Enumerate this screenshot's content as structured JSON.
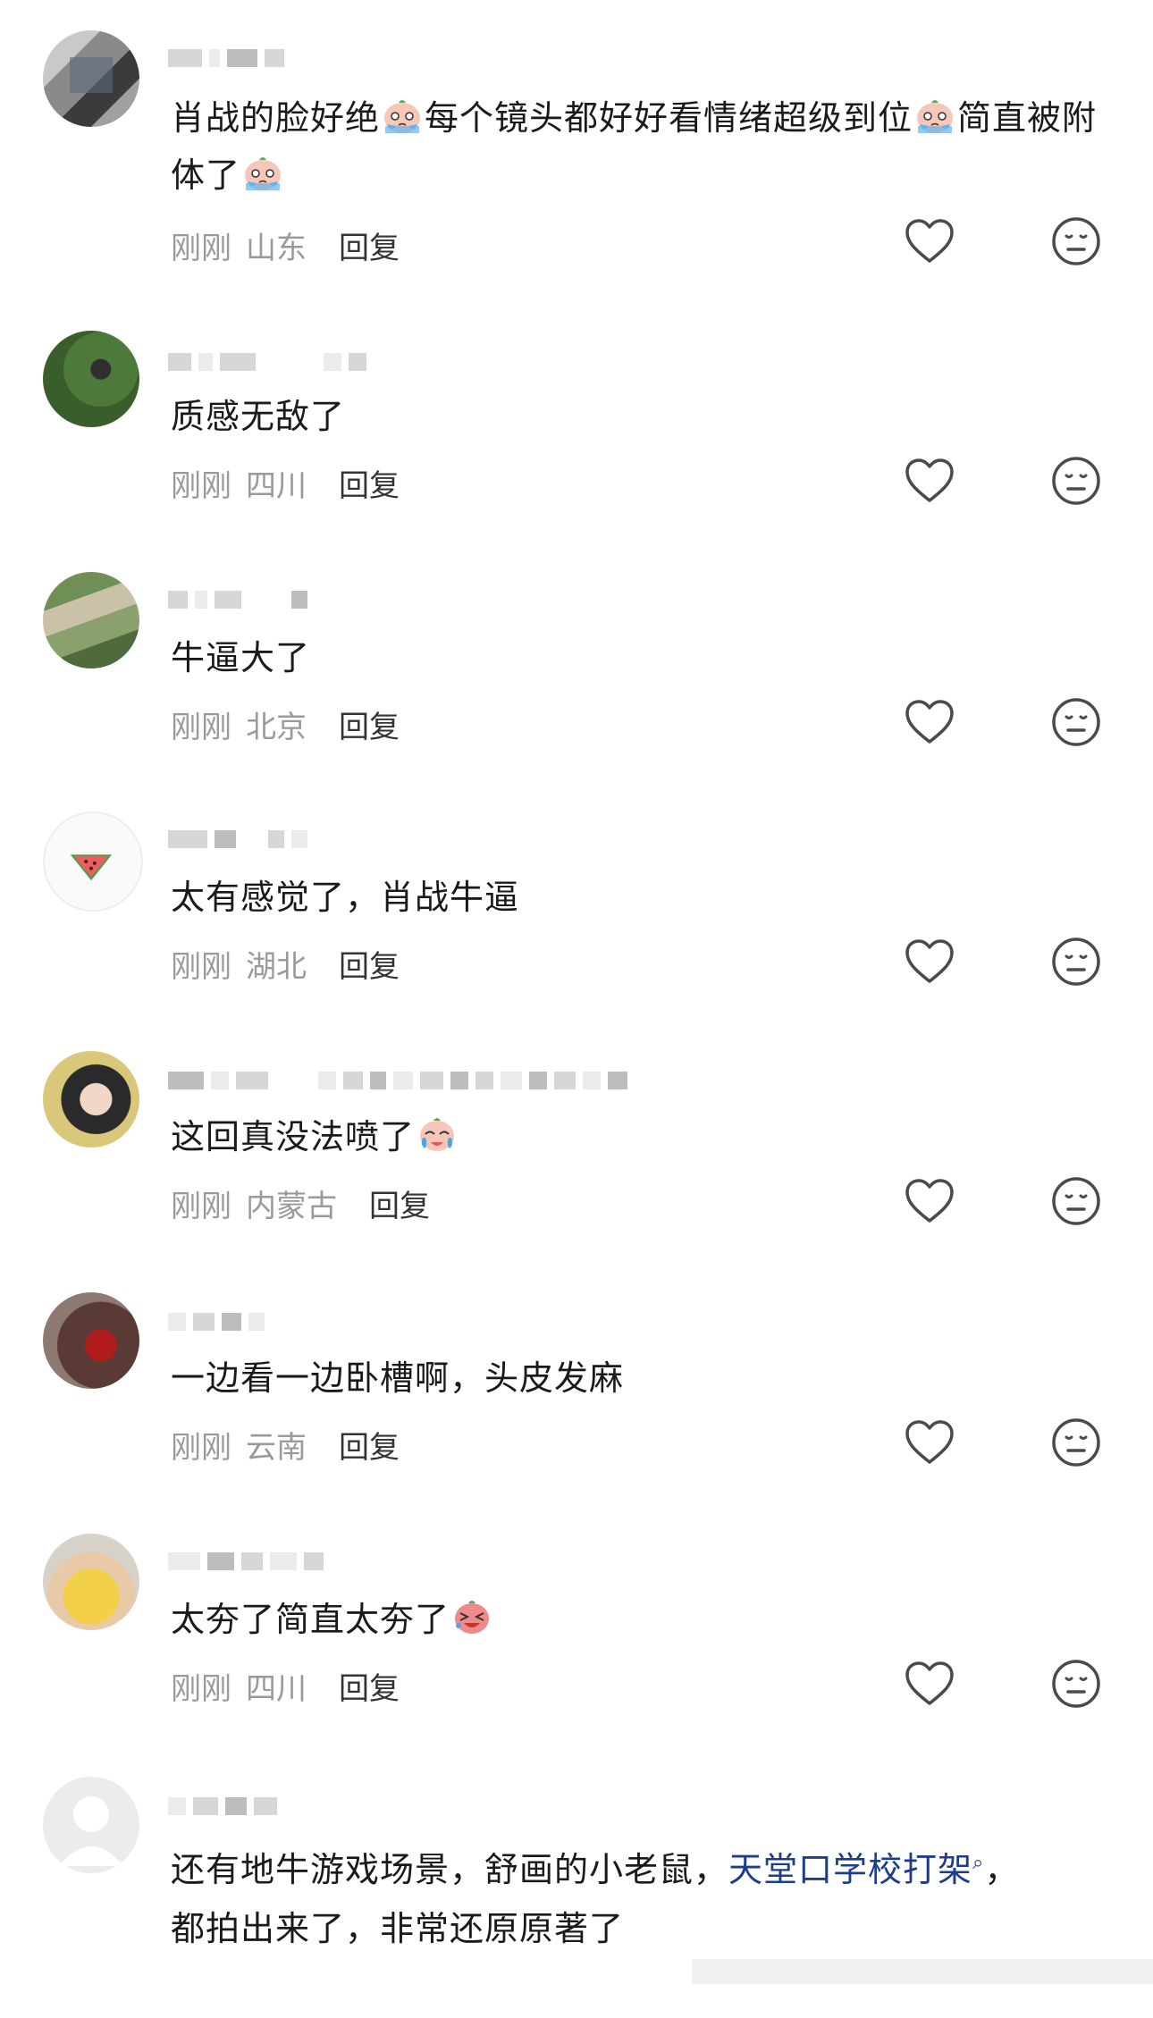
{
  "comments": [
    {
      "text_parts": [
        "肖战的脸好绝",
        "每个镜头都好好看情绪超级到位",
        "简直被附体了"
      ],
      "time": "刚刚",
      "location": "山东",
      "reply": "回复"
    },
    {
      "text": "质感无敌了",
      "time": "刚刚",
      "location": "四川",
      "reply": "回复"
    },
    {
      "text": "牛逼大了",
      "time": "刚刚",
      "location": "北京",
      "reply": "回复"
    },
    {
      "text": "太有感觉了，肖战牛逼",
      "time": "刚刚",
      "location": "湖北",
      "reply": "回复"
    },
    {
      "text": "这回真没法喷了",
      "time": "刚刚",
      "location": "内蒙古",
      "reply": "回复"
    },
    {
      "text": "一边看一边卧槽啊，头皮发麻",
      "time": "刚刚",
      "location": "云南",
      "reply": "回复"
    },
    {
      "text": "太夯了简直太夯了",
      "time": "刚刚",
      "location": "四川",
      "reply": "回复"
    },
    {
      "text_before_link": "还有地牛游戏场景，舒画的小老鼠，",
      "link": "天堂口学校打架",
      "text_after_link": "，",
      "text_line2": "都拍出来了，非常还原原著了"
    }
  ],
  "icons": {
    "like": "heart-outline-icon",
    "dislike": "neutral-face-icon"
  },
  "colors": {
    "meta": "#9a9a9a",
    "reply": "#333333",
    "link": "#1c3c8c"
  }
}
